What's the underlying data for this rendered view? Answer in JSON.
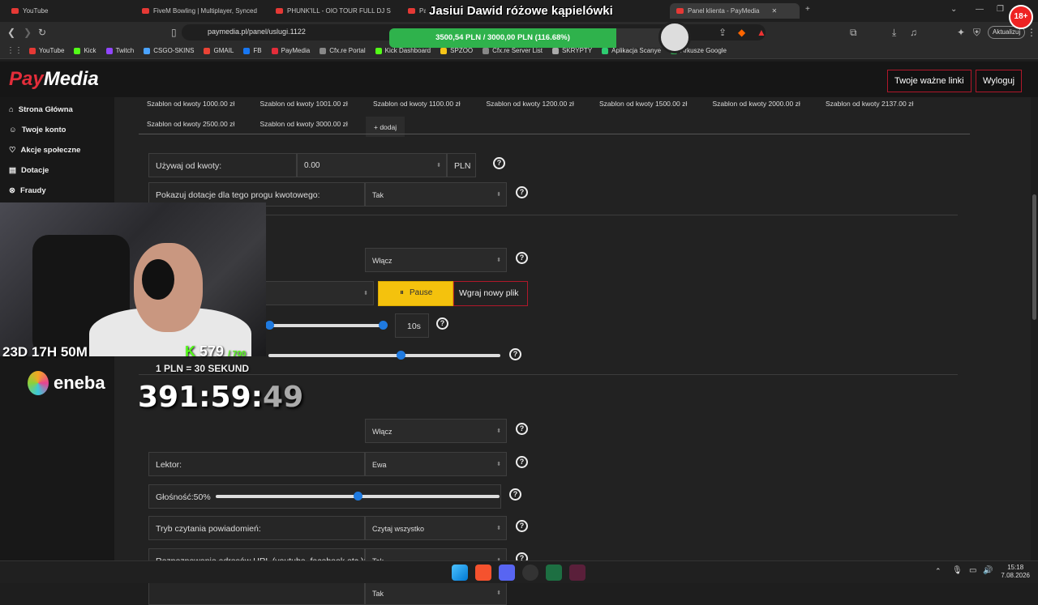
{
  "browser": {
    "tabs": [
      {
        "label": "YouTube"
      },
      {
        "label": "FiveM Bowling | Multiplayer, Synced"
      },
      {
        "label": "PHUNK'ILL - OIO TOUR FULL DJ S"
      },
      {
        "label": "Pay"
      },
      {
        "label": "Panel klienta - PayMedia"
      }
    ],
    "new_tab": "+",
    "url": "paymedia.pl/panel/uslugi.1122",
    "update_label": "Aktualizuj",
    "bookmarks": [
      {
        "label": "YouTube",
        "color": "#e53935"
      },
      {
        "label": "Kick",
        "color": "#53fc18"
      },
      {
        "label": "Twitch",
        "color": "#9146ff"
      },
      {
        "label": "CSGO-SKINS",
        "color": "#4aa3ff"
      },
      {
        "label": "GMAIL",
        "color": "#ea4335"
      },
      {
        "label": "FB",
        "color": "#1877f2"
      },
      {
        "label": "PayMedia",
        "color": "#e32d3a"
      },
      {
        "label": "Cfx.re Portal",
        "color": "#888888"
      },
      {
        "label": "Kick Dashboard",
        "color": "#53fc18"
      },
      {
        "label": "SPZOO",
        "color": "#f5c518"
      },
      {
        "label": "Cfx.re Server List",
        "color": "#888888"
      },
      {
        "label": "SKRYPTY",
        "color": "#aaaaaa"
      },
      {
        "label": "Aplikacja Scanye",
        "color": "#2ecc71"
      },
      {
        "label": "Arkusze Google",
        "color": "#34a853"
      }
    ]
  },
  "site": {
    "logo_pay": "Pay",
    "logo_media": "Media",
    "links_button": "Twoje ważne linki",
    "logout_button": "Wyloguj"
  },
  "sidebar": {
    "items": [
      {
        "label": "Strona Główna",
        "icon": "home-icon"
      },
      {
        "label": "Twoje konto",
        "icon": "user-icon"
      },
      {
        "label": "Akcje społeczne",
        "icon": "heart-icon"
      },
      {
        "label": "Dotacje",
        "icon": "document-icon"
      },
      {
        "label": "Fraudy",
        "icon": "block-icon"
      }
    ]
  },
  "templates": {
    "row1": [
      "Szablon od kwoty 1000.00 zł",
      "Szablon od kwoty 1001.00 zł",
      "Szablon od kwoty 1100.00 zł",
      "Szablon od kwoty 1200.00 zł",
      "Szablon od kwoty 1500.00 zł",
      "Szablon od kwoty 2000.00 zł",
      "Szablon od kwoty 2137.00 zł"
    ],
    "row2": [
      "Szablon od kwoty 2500.00 zł",
      "Szablon od kwoty 3000.00 zł"
    ],
    "add_label": "+ dodaj"
  },
  "form": {
    "min_amount_label": "Używaj od kwoty:",
    "min_amount_value": "0.00",
    "currency": "PLN",
    "show_tier_label": "Pokazuj dotacje dla tego progu kwotowego:",
    "show_tier_value": "Tak",
    "sound_toggle_value": "Włącz",
    "pause_button": "Pause",
    "upload_button": "Wgraj nowy plik",
    "duration_value": "10s",
    "tts_toggle_value": "Włącz",
    "voice_label": "Lektor:",
    "voice_value": "Ewa",
    "volume_label": "Głośność:50%",
    "volume_level": 0.5,
    "read_mode_label": "Tryb czytania powiadomień:",
    "read_mode_value": "Czytaj wszystko",
    "url_detect_label": "Rozpoznawanie adresów URL (youtube, facebook etc.):",
    "url_detect_value": "Tak",
    "special_chars_value": "Tak",
    "help_symbol": "?"
  },
  "overlay": {
    "goal_title": "Jasiui Dawid różowe kąpielówki",
    "goal_text": "3500,54 PLN / 3000,00 PLN  (116.68%)",
    "goal_progress": 1.0,
    "age_badge": "18+",
    "countdown": "23D 17H 50M",
    "kick_count": "579",
    "kick_max": "/ 700",
    "rate": "1 PLN = 30 SEKUND",
    "sponsor": "eneba",
    "timer_main": "391:59:",
    "timer_seconds": "49"
  },
  "taskbar": {
    "time": "15:18",
    "date": "7.08.2026"
  }
}
